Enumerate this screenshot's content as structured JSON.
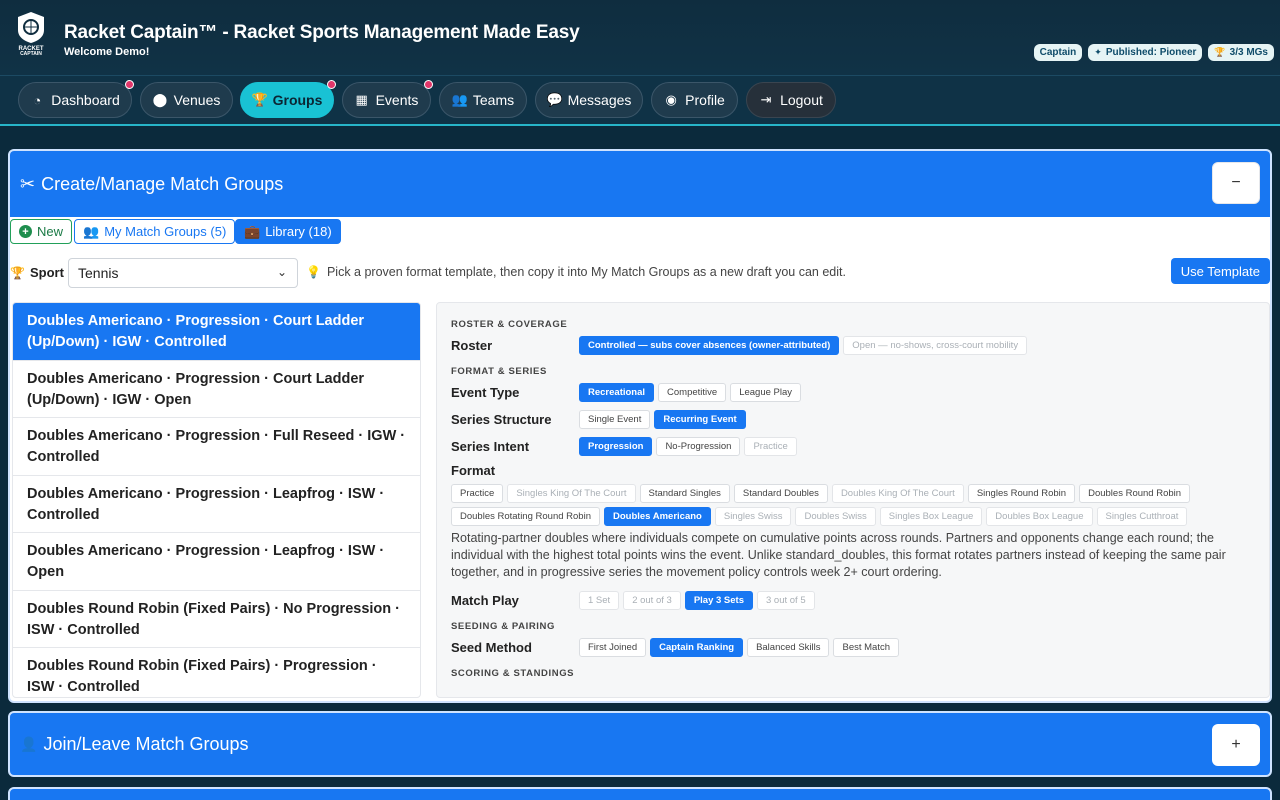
{
  "header": {
    "title": "Racket Captain™ - Racket Sports Management Made Easy",
    "welcome": "Welcome Demo!",
    "badges": [
      {
        "label": "Captain",
        "icon": ""
      },
      {
        "label": "Published: Pioneer",
        "icon": "sparkle-icon"
      },
      {
        "label": "3/3 MGs",
        "icon": "trophy-icon"
      }
    ]
  },
  "nav": [
    {
      "label": "Dashboard",
      "icon": "gauge-icon",
      "dot": true
    },
    {
      "label": "Venues",
      "icon": "map-pin-icon",
      "dot": false
    },
    {
      "label": "Groups",
      "icon": "trophy-icon",
      "dot": true,
      "active": true
    },
    {
      "label": "Events",
      "icon": "calendar-icon",
      "dot": true
    },
    {
      "label": "Teams",
      "icon": "users-icon",
      "dot": false
    },
    {
      "label": "Messages",
      "icon": "chat-icon",
      "dot": false
    },
    {
      "label": "Profile",
      "icon": "user-circle-icon",
      "dot": false
    },
    {
      "label": "Logout",
      "icon": "logout-icon",
      "dot": false
    }
  ],
  "panel": {
    "title": "Create/Manage Match Groups",
    "collapse": "−",
    "tabs": {
      "new": "New",
      "mine": "My Match Groups (5)",
      "library": "Library (18)"
    },
    "sport_label": "Sport",
    "sport_value": "Tennis",
    "hint": "Pick a proven format template, then copy it into My Match Groups as a new draft you can edit.",
    "use_template": "Use Template",
    "templates": [
      "Doubles Americano · Progression · Court Ladder (Up/Down) · IGW · Controlled",
      "Doubles Americano · Progression · Court Ladder (Up/Down) · IGW · Open",
      "Doubles Americano · Progression · Full Reseed · IGW · Controlled",
      "Doubles Americano · Progression · Leapfrog · ISW · Controlled",
      "Doubles Americano · Progression · Leapfrog · ISW · Open",
      "Doubles Round Robin (Fixed Pairs) · No Progression · ISW · Controlled",
      "Doubles Round Robin (Fixed Pairs) · Progression · ISW · Controlled"
    ]
  },
  "detail": {
    "roster_section": "ROSTER & COVERAGE",
    "roster_label": "Roster",
    "roster_options": [
      "Controlled — subs cover absences (owner-attributed)",
      "Open — no-shows, cross-court mobility"
    ],
    "format_section": "FORMAT & SERIES",
    "event_type_label": "Event Type",
    "event_type_options": [
      "Recreational",
      "Competitive",
      "League Play"
    ],
    "series_structure_label": "Series Structure",
    "series_structure_options": [
      "Single Event",
      "Recurring Event"
    ],
    "series_intent_label": "Series Intent",
    "series_intent_options": [
      "Progression",
      "No-Progression",
      "Practice"
    ],
    "format_label": "Format",
    "format_options": [
      "Practice",
      "Singles King Of The Court",
      "Standard Singles",
      "Standard Doubles",
      "Doubles King Of The Court",
      "Singles Round Robin",
      "Doubles Round Robin",
      "Doubles Rotating Round Robin",
      "Doubles Americano",
      "Singles Swiss",
      "Doubles Swiss",
      "Singles Box League",
      "Doubles Box League",
      "Singles Cutthroat"
    ],
    "format_description": "Rotating-partner doubles where individuals compete on cumulative points across rounds. Partners and opponents change each round; the individual with the highest total points wins the event. Unlike standard_doubles, this format rotates partners instead of keeping the same pair together, and in progressive series the movement policy controls week 2+ court ordering.",
    "match_play_label": "Match Play",
    "match_play_options": [
      "1 Set",
      "2 out of 3",
      "Play 3 Sets",
      "3 out of 5"
    ],
    "seeding_section": "SEEDING & PAIRING",
    "seed_method_label": "Seed Method",
    "seed_method_options": [
      "First Joined",
      "Captain Ranking",
      "Balanced Skills",
      "Best Match"
    ],
    "scoring_section": "SCORING & STANDINGS"
  },
  "join_panel": {
    "title": "Join/Leave Match Groups",
    "expand": "+"
  }
}
